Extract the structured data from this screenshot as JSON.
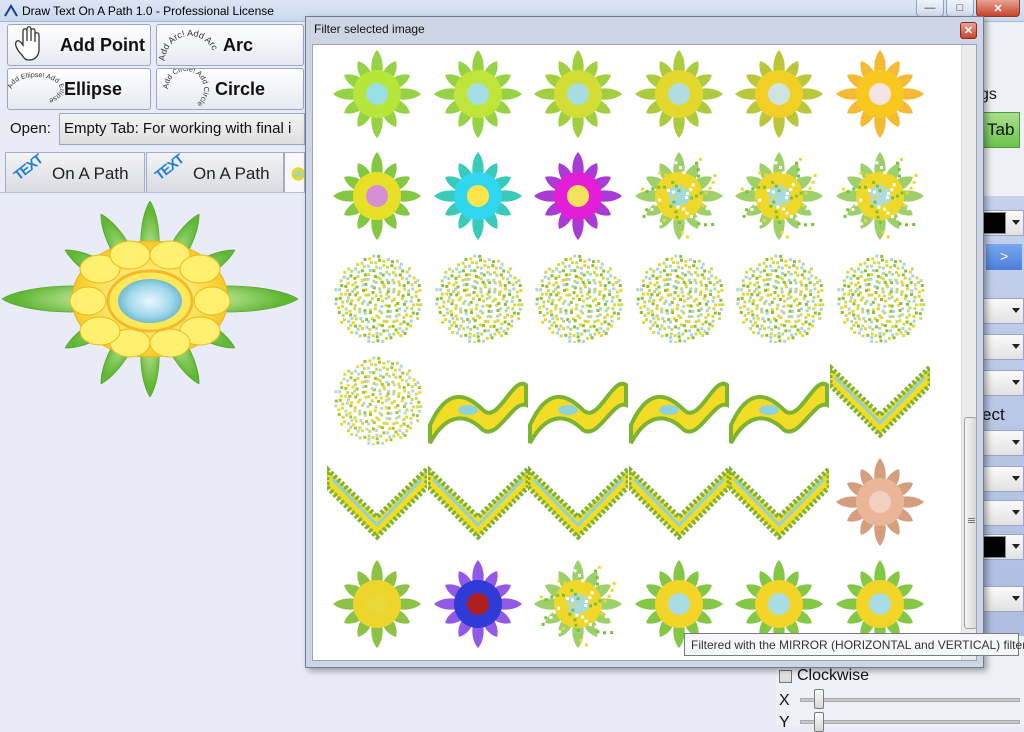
{
  "window": {
    "title": "Draw Text On A Path 1.0 - Professional License",
    "buttons": {
      "minimize": "—",
      "maximize": "□",
      "close": "✕"
    }
  },
  "toolbar": {
    "add_point": "Add Point",
    "arc": "Arc",
    "arc_icon_text": "Add Arc! Add Arc",
    "ellipse": "Ellipse",
    "ellipse_icon_text": "Add Ellipse! Add Ellipse",
    "circle": "Circle",
    "circle_icon_text": "Add Circle! Add Circle"
  },
  "open": {
    "label": "Open:",
    "value": "Empty Tab: For working with final i"
  },
  "tabs": [
    {
      "icon_text": "TEXT",
      "label": "On A Path"
    },
    {
      "icon_text": "TEXT",
      "label": "On A Path"
    }
  ],
  "right_panel": {
    "settings_fragment": "gs",
    "tab_fragment": "Tab",
    "next_arrow": ">",
    "effect_fragment": "ect"
  },
  "options": {
    "clockwise": "Clockwise",
    "x_label": "X",
    "y_label": "Y"
  },
  "dialog": {
    "title": "Filter selected image",
    "close": "✕",
    "tooltip": "Filtered with the MIRROR (HORIZONTAL and VERTICAL) filter."
  },
  "thumbnails": [
    {
      "kind": "flower",
      "petal": "#8fd13a",
      "center": "#9adfe6",
      "ring": "#b7e63a"
    },
    {
      "kind": "flower",
      "petal": "#8fd13a",
      "center": "#a5dfe6",
      "ring": "#bfe53a"
    },
    {
      "kind": "flower",
      "petal": "#9ccc36",
      "center": "#a5dde0",
      "ring": "#d2de35"
    },
    {
      "kind": "flower",
      "petal": "#a8c935",
      "center": "#b2dde0",
      "ring": "#e4d82f"
    },
    {
      "kind": "flower",
      "petal": "#b6c42f",
      "center": "#cfe3e0",
      "ring": "#f1cf25"
    },
    {
      "kind": "flower",
      "petal": "#f5b52a",
      "center": "#f5e4e4",
      "ring": "#f8c81e"
    },
    {
      "kind": "flower",
      "petal": "#7dc439",
      "center": "#d48fd6",
      "ring": "#e8e028"
    },
    {
      "kind": "flower",
      "petal": "#2ec8b6",
      "center": "#ffe44a",
      "ring": "#31d6f0"
    },
    {
      "kind": "flower",
      "petal": "#a42fd2",
      "center": "#f6e25a",
      "ring": "#e21ed6"
    },
    {
      "kind": "noisy",
      "petal": "#7cc03a",
      "center": "#9fdbe0",
      "ring": "#f0d82a"
    },
    {
      "kind": "noisy",
      "petal": "#7cc03a",
      "center": "#a7dbe0",
      "ring": "#f0d82a"
    },
    {
      "kind": "noisy",
      "petal": "#7cc03a",
      "center": "#afdbe0",
      "ring": "#f0d82a"
    },
    {
      "kind": "scatter",
      "petal": "#8cbf35",
      "center": "#a7d6d8",
      "ring": "#e8d630"
    },
    {
      "kind": "scatter",
      "petal": "#8cbf35",
      "center": "#a7d6d8",
      "ring": "#e8d630"
    },
    {
      "kind": "scatter",
      "petal": "#8cbf35",
      "center": "#a7d6d8",
      "ring": "#e8d630"
    },
    {
      "kind": "scatter",
      "petal": "#8cbf35",
      "center": "#a7d6d8",
      "ring": "#e8d630"
    },
    {
      "kind": "scatter",
      "petal": "#8cbf35",
      "center": "#a7d6d8",
      "ring": "#e8d630"
    },
    {
      "kind": "scatter",
      "petal": "#8cbf35",
      "center": "#a7d6d8",
      "ring": "#e8d630"
    },
    {
      "kind": "scatter",
      "petal": "#a8c433",
      "center": "#b7d9d6",
      "ring": "#ecd83a"
    },
    {
      "kind": "wave",
      "petal": "#7cb332",
      "center": "#8ed2dc",
      "ring": "#f2dc26"
    },
    {
      "kind": "wave",
      "petal": "#7cb332",
      "center": "#8ed2dc",
      "ring": "#f2dc26"
    },
    {
      "kind": "wave",
      "petal": "#7cb332",
      "center": "#8ed2dc",
      "ring": "#f2dc26"
    },
    {
      "kind": "wave",
      "petal": "#7cb332",
      "center": "#8ed2dc",
      "ring": "#f2dc26"
    },
    {
      "kind": "zig",
      "petal": "#7cb332",
      "center": "#8ed2dc",
      "ring": "#f2dc26"
    },
    {
      "kind": "zig",
      "petal": "#7cb332",
      "center": "#8ed2dc",
      "ring": "#f2dc26"
    },
    {
      "kind": "zig",
      "petal": "#7cb332",
      "center": "#8ed2dc",
      "ring": "#f2dc26"
    },
    {
      "kind": "zig",
      "petal": "#7cb332",
      "center": "#8ed2dc",
      "ring": "#f2dc26"
    },
    {
      "kind": "zig",
      "petal": "#7cb332",
      "center": "#8ed2dc",
      "ring": "#f2dc26"
    },
    {
      "kind": "zig",
      "petal": "#7cb332",
      "center": "#8ed2dc",
      "ring": "#f2dc26"
    },
    {
      "kind": "flower",
      "petal": "#d29a78",
      "center": "#f0d0c0",
      "ring": "#eab69a"
    },
    {
      "kind": "flower",
      "petal": "#86c03a",
      "center": "#e8d838",
      "ring": "#eed52b"
    },
    {
      "kind": "flower",
      "petal": "#8c4fe6",
      "center": "#b01f1f",
      "ring": "#2f3bd6"
    },
    {
      "kind": "noisy",
      "petal": "#7cc03a",
      "center": "#a7dbe0",
      "ring": "#f0d82a"
    },
    {
      "kind": "flower",
      "petal": "#7dc43a",
      "center": "#a8dde6",
      "ring": "#f2d526"
    },
    {
      "kind": "flower",
      "petal": "#7dc43a",
      "center": "#a8dde6",
      "ring": "#f2d526"
    },
    {
      "kind": "flower",
      "petal": "#7dc43a",
      "center": "#a8dde6",
      "ring": "#f2d526"
    }
  ]
}
